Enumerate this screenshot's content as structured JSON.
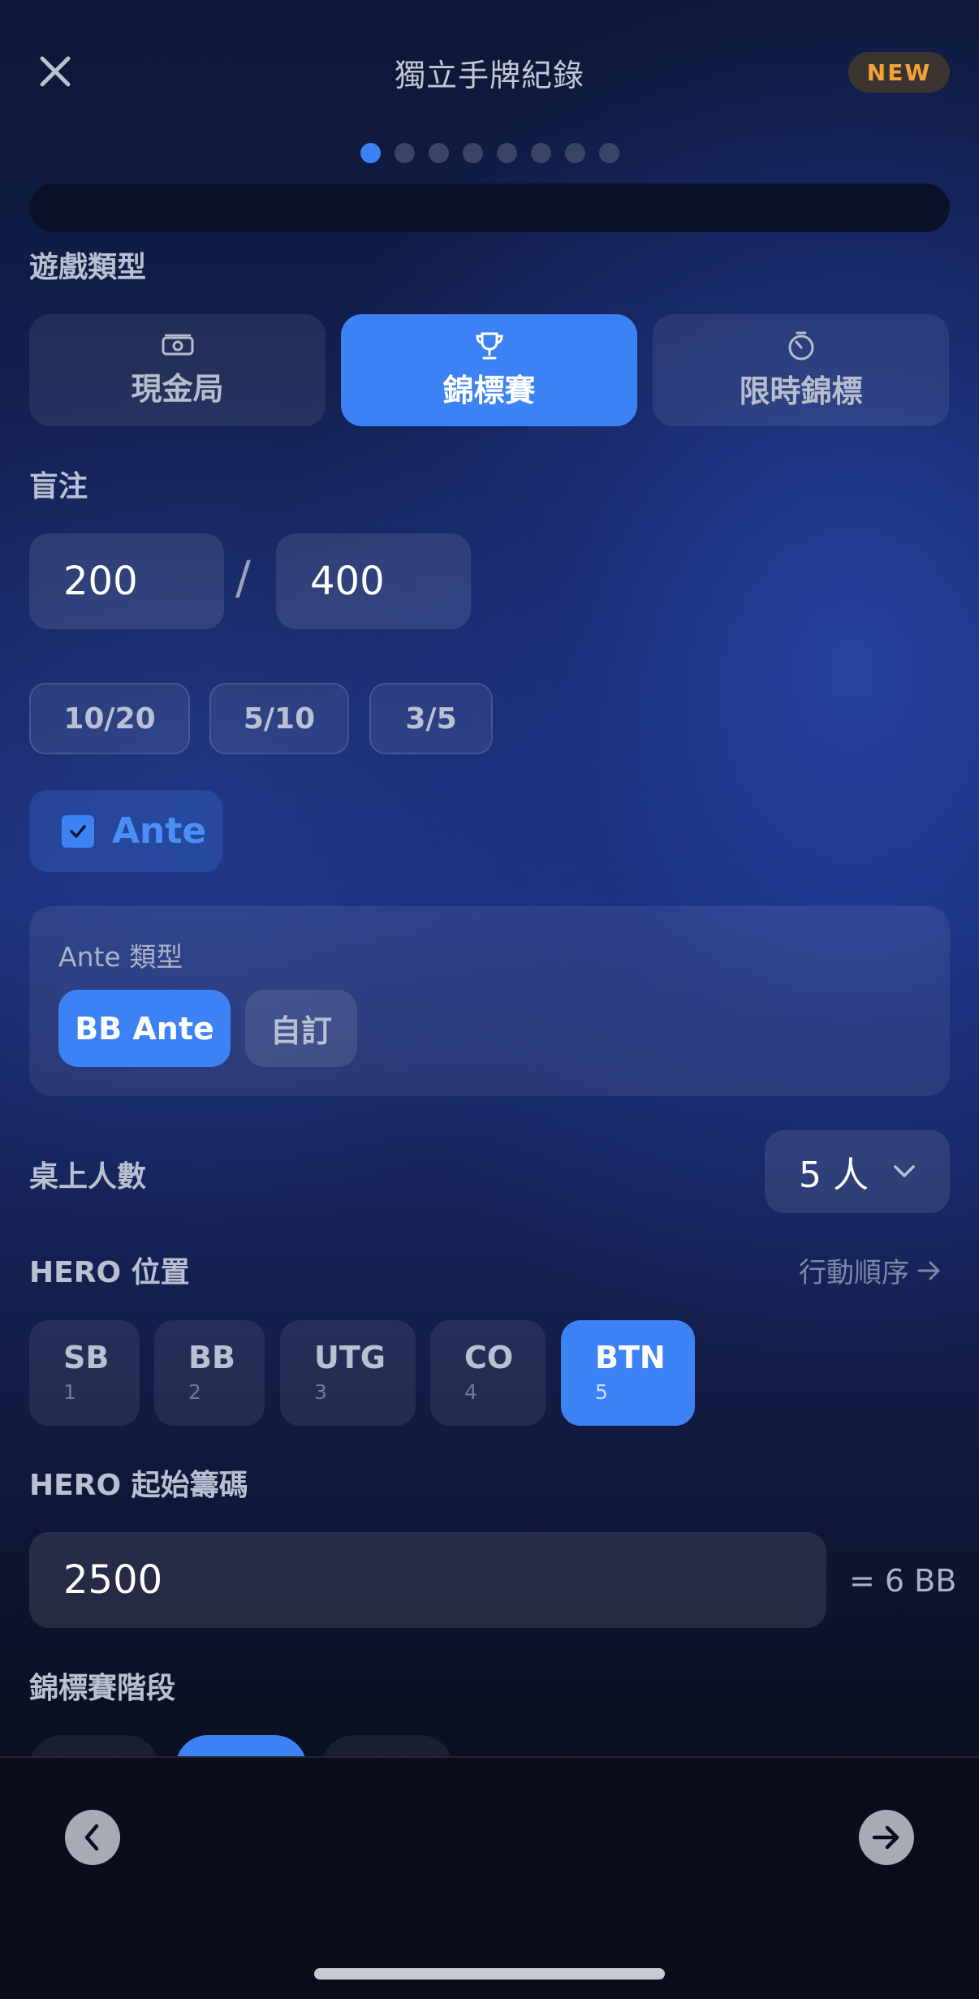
{
  "header": {
    "title": "獨立手牌紀錄",
    "badge": "NEW"
  },
  "progress": {
    "total_steps": 8,
    "current_step": 1
  },
  "game_type": {
    "label": "遊戲類型",
    "options": [
      {
        "label": "現金局",
        "icon": "cash-icon"
      },
      {
        "label": "錦標賽",
        "icon": "trophy-icon"
      },
      {
        "label": "限時錦標",
        "icon": "timer-icon"
      }
    ],
    "selected": "錦標賽"
  },
  "blinds": {
    "label": "盲注",
    "small": "200",
    "separator": "/",
    "big": "400",
    "presets": [
      "10/20",
      "5/10",
      "3/5"
    ]
  },
  "ante": {
    "label": "Ante",
    "checked": true,
    "type_label": "Ante 類型",
    "types": [
      "BB Ante",
      "自訂"
    ],
    "selected_type": "BB Ante"
  },
  "players": {
    "label": "桌上人數",
    "value": "5 人"
  },
  "hero_position": {
    "label": "HERO 位置",
    "order_link": "行動順序",
    "positions": [
      {
        "name": "SB",
        "num": "1"
      },
      {
        "name": "BB",
        "num": "2"
      },
      {
        "name": "UTG",
        "num": "3"
      },
      {
        "name": "CO",
        "num": "4"
      },
      {
        "name": "BTN",
        "num": "5"
      }
    ],
    "selected": "BTN"
  },
  "hero_stack": {
    "label": "HERO 起始籌碼",
    "value": "2500",
    "bb_equivalent": "= 6 BB"
  },
  "tournament_stage": {
    "label": "錦標賽階段",
    "selected_index": 1
  },
  "colors": {
    "accent": "#3d82f5",
    "badge_text": "#f2a23a"
  }
}
